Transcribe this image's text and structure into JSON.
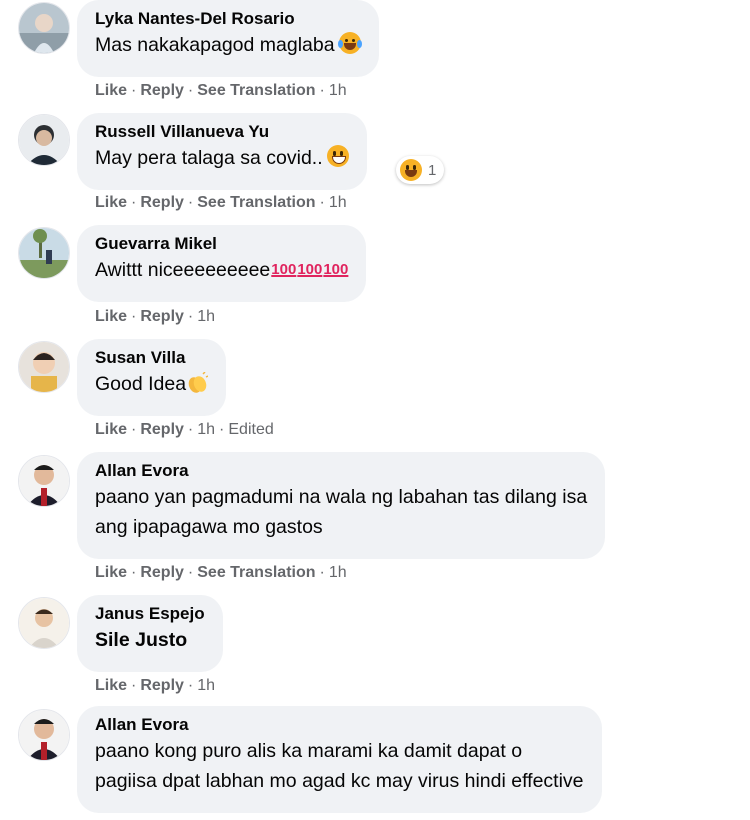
{
  "action_labels": {
    "like": "Like",
    "reply": "Reply",
    "see_translation": "See Translation",
    "edited": "Edited",
    "dot": "·"
  },
  "comments": [
    {
      "author": "Lyka Nantes-Del Rosario",
      "text": "Mas nakakapagod maglaba",
      "time": "1h"
    },
    {
      "author": "Russell Villanueva Yu",
      "text": "May pera talaga sa covid..",
      "time": "1h",
      "reaction_count": "1"
    },
    {
      "author": "Guevarra Mikel",
      "text": "Awittt niceeeeeeeee",
      "emoji_text": "100",
      "time": "1h"
    },
    {
      "author": "Susan Villa",
      "text": "Good Idea",
      "time": "1h"
    },
    {
      "author": "Allan Evora",
      "lines": [
        "paano yan pagmadumi na wala ng labahan tas dilang isa",
        "ang ipapagawa mo gastos"
      ],
      "time": "1h"
    },
    {
      "author": "Janus Espejo",
      "text": "Sile Justo",
      "time": "1h"
    },
    {
      "author": "Allan Evora",
      "lines": [
        "paano kong puro alis ka marami ka damit dapat o",
        "pagiisa dpat labhan mo agad kc may virus hindi effective"
      ]
    }
  ]
}
